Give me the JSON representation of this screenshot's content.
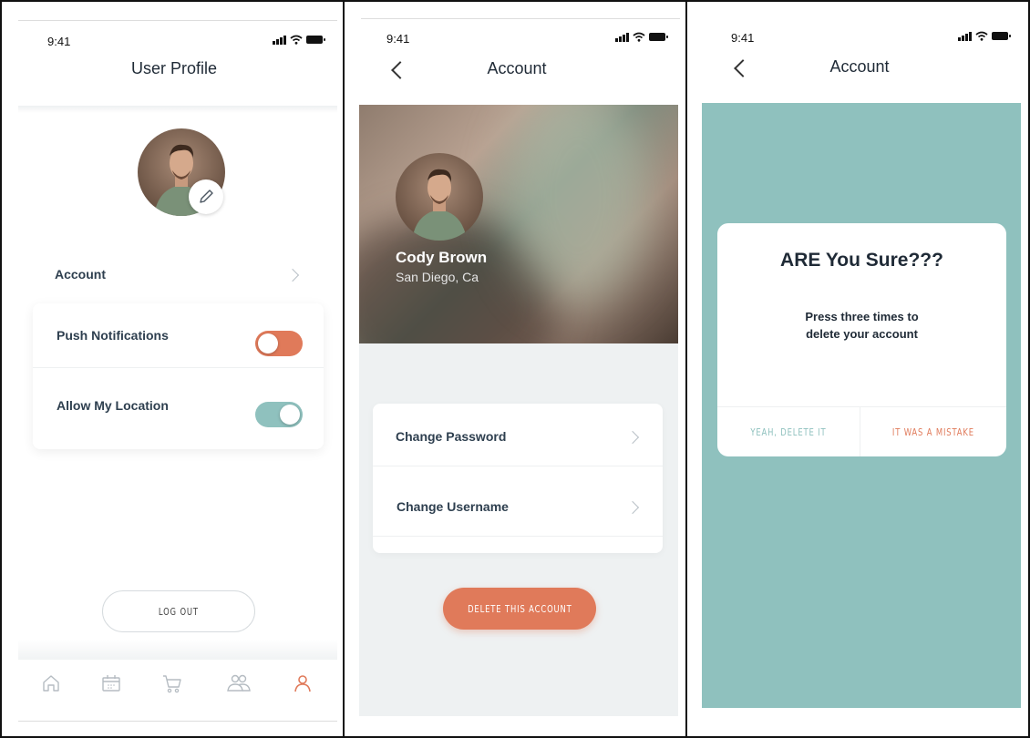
{
  "status": {
    "time": "9:41"
  },
  "profile_screen": {
    "title": "User Profile",
    "rows": {
      "account": "Account",
      "push_notifications": "Push Notifications",
      "push_notifications_on": false,
      "allow_location": "Allow My Location",
      "allow_location_on": true
    },
    "logout_label": "LOG OUT",
    "nav": [
      "home-icon",
      "calendar-icon",
      "cart-icon",
      "people-icon",
      "user-icon"
    ],
    "active_nav": "user-icon"
  },
  "account_screen": {
    "title": "Account",
    "user": {
      "name": "Cody Brown",
      "location": "San Diego, Ca"
    },
    "menu": [
      "Change Password",
      "Change Username"
    ],
    "delete_label": "DELETE THIS ACCOUNT"
  },
  "confirm_screen": {
    "title": "Account",
    "dialog": {
      "heading": "ARE You Sure???",
      "message_line1": "Press three times to",
      "message_line2": "delete your account",
      "confirm_label": "YEAH, DELETE IT",
      "cancel_label": "IT WAS A MISTAKE"
    }
  },
  "colors": {
    "accent_orange": "#e07a5a",
    "accent_teal": "#8fc1be",
    "text_dark": "#2e3f4f"
  }
}
